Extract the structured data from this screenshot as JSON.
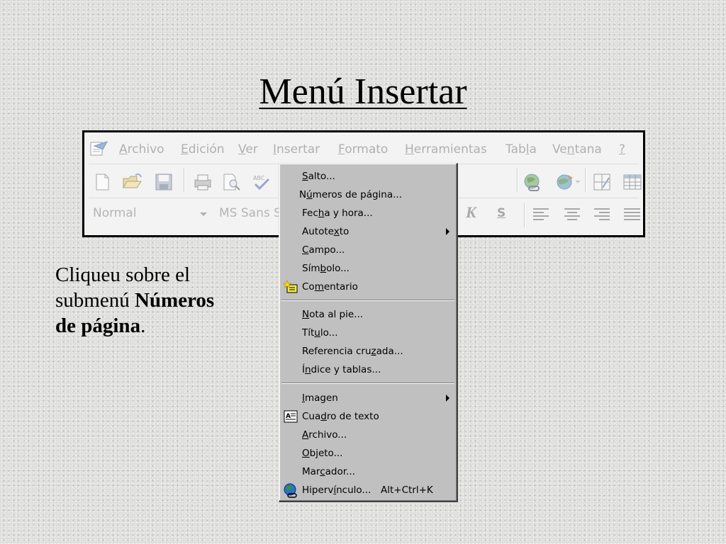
{
  "slide": {
    "title": "Menú Insertar",
    "instruction": {
      "line1": "Cliqueu sobre el",
      "line2_prefix": "submenú ",
      "bold1": "Números",
      "bold2": "de página",
      "suffix": "."
    }
  },
  "menubar": {
    "items": [
      {
        "pre": "",
        "ul": "A",
        "post": "rchivo"
      },
      {
        "pre": "",
        "ul": "E",
        "post": "dición"
      },
      {
        "pre": "",
        "ul": "V",
        "post": "er"
      },
      {
        "pre": "",
        "ul": "I",
        "post": "nsertar"
      },
      {
        "pre": "",
        "ul": "F",
        "post": "ormato"
      },
      {
        "pre": "",
        "ul": "H",
        "post": "erramientas"
      },
      {
        "pre": "Tab",
        "ul": "l",
        "post": "a"
      },
      {
        "pre": "Ve",
        "ul": "n",
        "post": "tana"
      },
      {
        "pre": "",
        "ul": "?",
        "post": ""
      }
    ]
  },
  "format_bar": {
    "style": "Normal",
    "font": "MS Sans S",
    "italic": "K",
    "underline": "S"
  },
  "insert_menu": {
    "items": [
      {
        "pre": "",
        "ul": "S",
        "post": "alto...",
        "submenu": false,
        "icon": "",
        "shortcut": ""
      },
      {
        "pre": "N",
        "ul": "ú",
        "post": "meros de página...",
        "submenu": false,
        "icon": "",
        "shortcut": ""
      },
      {
        "pre": "Fec",
        "ul": "h",
        "post": "a y hora...",
        "submenu": false,
        "icon": "",
        "shortcut": ""
      },
      {
        "pre": "Autote",
        "ul": "x",
        "post": "to",
        "submenu": true,
        "icon": "",
        "shortcut": ""
      },
      {
        "pre": "",
        "ul": "C",
        "post": "ampo...",
        "submenu": false,
        "icon": "",
        "shortcut": ""
      },
      {
        "pre": "Sím",
        "ul": "b",
        "post": "olo...",
        "submenu": false,
        "icon": "",
        "shortcut": ""
      },
      {
        "pre": "Co",
        "ul": "m",
        "post": "entario",
        "submenu": false,
        "icon": "comment-icon",
        "shortcut": ""
      },
      {
        "pre": "",
        "ul": "N",
        "post": "ota al pie...",
        "submenu": false,
        "icon": "",
        "shortcut": ""
      },
      {
        "pre": "Tít",
        "ul": "u",
        "post": "lo...",
        "submenu": false,
        "icon": "",
        "shortcut": ""
      },
      {
        "pre": "Referencia cru",
        "ul": "z",
        "post": "ada...",
        "submenu": false,
        "icon": "",
        "shortcut": ""
      },
      {
        "pre": "Í",
        "ul": "n",
        "post": "dice y tablas...",
        "submenu": false,
        "icon": "",
        "shortcut": ""
      },
      {
        "pre": "",
        "ul": "I",
        "post": "magen",
        "submenu": true,
        "icon": "",
        "shortcut": ""
      },
      {
        "pre": "Cua",
        "ul": "d",
        "post": "ro de texto",
        "submenu": false,
        "icon": "text-box-icon",
        "shortcut": ""
      },
      {
        "pre": "",
        "ul": "A",
        "post": "rchivo...",
        "submenu": false,
        "icon": "",
        "shortcut": ""
      },
      {
        "pre": "",
        "ul": "O",
        "post": "bjeto...",
        "submenu": false,
        "icon": "",
        "shortcut": ""
      },
      {
        "pre": "Mar",
        "ul": "c",
        "post": "ador...",
        "submenu": false,
        "icon": "",
        "shortcut": ""
      },
      {
        "pre": "Hiperv",
        "ul": "í",
        "post": "nculo...",
        "submenu": false,
        "icon": "hyperlink-globe-icon",
        "shortcut": "Alt+Ctrl+K"
      }
    ]
  }
}
